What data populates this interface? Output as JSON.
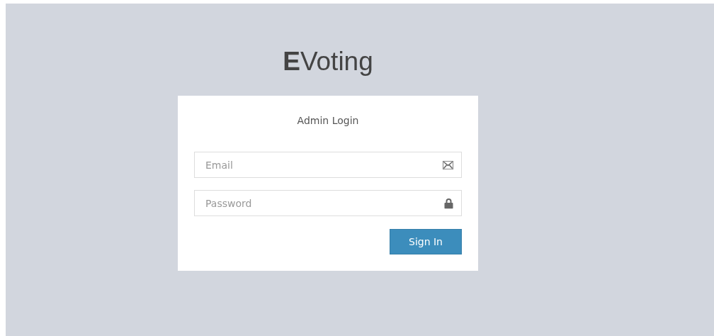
{
  "logo": "**E**Voting",
  "login_box": {
    "title": "Admin Login",
    "fields": [
      {
        "placeholder": "Email",
        "kind": "email"
      },
      {
        "placeholder": "Password",
        "kind": "password"
      }
    ],
    "button": "Sign In"
  }
}
